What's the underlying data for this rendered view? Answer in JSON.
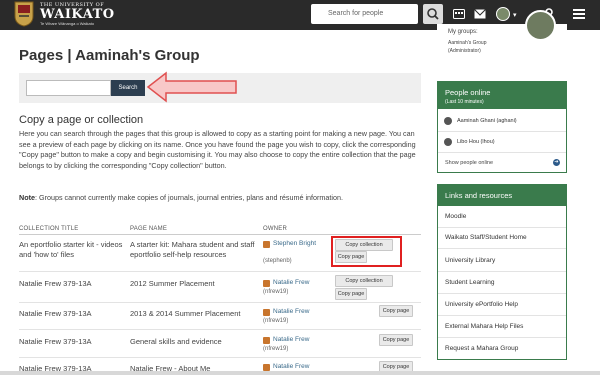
{
  "header": {
    "university_small": "THE UNIVERSITY OF",
    "university_name": "WAIKATO",
    "tagline": "Te Whare Wānanga o Waikato",
    "search_placeholder": "Search for people"
  },
  "main": {
    "title": "Pages | Aaminah's Group",
    "search_button": "Search",
    "section_title": "Copy a page or collection",
    "description": "Here you can search through the pages that this group is allowed to copy as a starting point for making a new page. You can see a preview of each page by clicking on its name. Once you have found the page you wish to copy, click the corresponding \"Copy page\" button to make a copy and begin customising it. You may also choose to copy the entire collection that the page belongs to by clicking the corresponding \"Copy collection\" button.",
    "note_label": "Note",
    "note_text": ": Groups cannot currently make copies of journals, journal entries, plans and résumé information.",
    "table": {
      "headers": [
        "COLLECTION TITLE",
        "PAGE NAME",
        "OWNER"
      ],
      "rows": [
        {
          "collection": "An eportfolio starter kit - videos and 'how to' files",
          "page": "A starter kit: Mahara student and staff eportfolio self-help resources",
          "owner": "Stephen Bright",
          "username": "(stephenb)",
          "copy_collection": "Copy collection",
          "copy_page": "Copy page"
        },
        {
          "collection": "Natalie Frew 379-13A",
          "page": "2012 Summer Placement",
          "owner": "Natalie Frew",
          "username": "(nfrew19)",
          "copy_collection": "Copy collection",
          "copy_page": "Copy page"
        },
        {
          "collection": "Natalie Frew 379-13A",
          "page": "2013 & 2014 Summer Placement",
          "owner": "Natalie Frew",
          "username": "(nfrew19)",
          "copy_page": "Copy page"
        },
        {
          "collection": "Natalie Frew 379-13A",
          "page": "General skills and evidence",
          "owner": "Natalie Frew",
          "username": "(nfrew19)",
          "copy_page": "Copy page"
        },
        {
          "collection": "Natalie Frew 379-13A",
          "page": "Natalie Frew - About Me",
          "owner": "Natalie Frew",
          "copy_page": "Copy page"
        }
      ]
    }
  },
  "sidebar": {
    "my_groups_label": "My groups:",
    "my_group_name": "Aaminah's Group",
    "my_group_role": "(Administrator)",
    "people_online": {
      "title": "People online",
      "subtitle": "(Last 10 minutes)",
      "people": [
        "Aaminah Ghani (aghani)",
        "Libo Hou (lhou)"
      ],
      "show_label": "Show people online"
    },
    "links": {
      "title": "Links and resources",
      "items": [
        "Moodle",
        "Waikato Staff/Student Home",
        "University Library",
        "Student Learning",
        "University ePortfolio Help",
        "External Mahara Help Files",
        "Request a Mahara Group"
      ]
    }
  }
}
